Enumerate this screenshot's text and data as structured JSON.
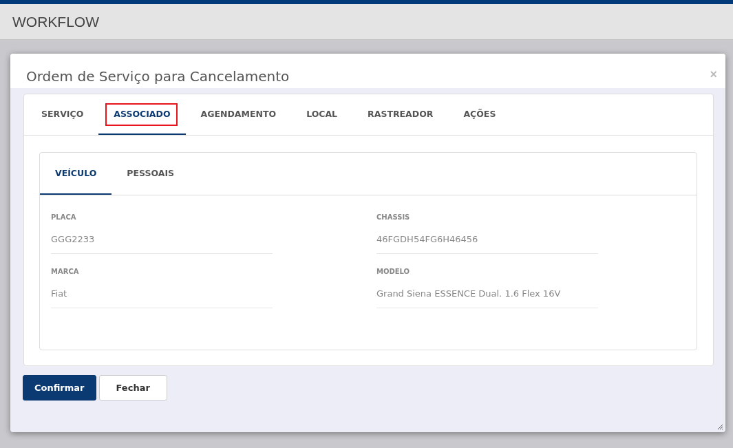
{
  "header": {
    "title": "WORKFLOW"
  },
  "modal": {
    "title": "Ordem de Serviço para Cancelamento",
    "close": "×",
    "tabs": [
      {
        "label": "SERVIÇO",
        "selected": false,
        "highlighted": false
      },
      {
        "label": "ASSOCIADO",
        "selected": true,
        "highlighted": true
      },
      {
        "label": "AGENDAMENTO",
        "selected": false,
        "highlighted": false
      },
      {
        "label": "LOCAL",
        "selected": false,
        "highlighted": false
      },
      {
        "label": "RASTREADOR",
        "selected": false,
        "highlighted": false
      },
      {
        "label": "AÇÕES",
        "selected": false,
        "highlighted": false
      }
    ],
    "subtabs": [
      {
        "label": "VEÍCULO",
        "selected": true
      },
      {
        "label": "PESSOAIS",
        "selected": false
      }
    ],
    "fields": [
      {
        "label": "PLACA",
        "value": "GGG2233"
      },
      {
        "label": "CHASSIS",
        "value": "46FGDH54FG6H46456"
      },
      {
        "label": "MARCA",
        "value": "Fiat"
      },
      {
        "label": "MODELO",
        "value": "Grand Siena ESSENCE Dual. 1.6 Flex 16V"
      }
    ],
    "buttons": [
      {
        "label": "Confirmar",
        "kind": "primary"
      },
      {
        "label": "Fechar",
        "kind": "default"
      }
    ]
  }
}
